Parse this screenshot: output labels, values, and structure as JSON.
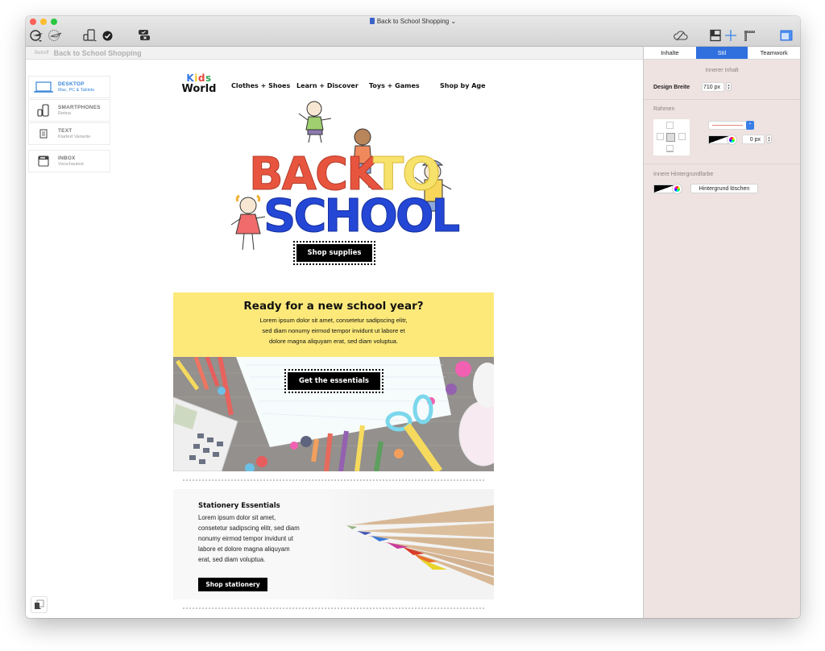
{
  "window": {
    "title": "Back to School Shopping",
    "title_chevron": "⌄"
  },
  "subject": {
    "label": "Betreff",
    "value": "Back to School Shopping"
  },
  "preview_tabs": [
    {
      "title": "DESKTOP",
      "subtitle": "Mac, PC & Tablets",
      "icon": "laptop-icon",
      "active": true
    },
    {
      "title": "SMARTPHONES",
      "subtitle": "Retina",
      "icon": "smartphone-icon",
      "active": false
    },
    {
      "title": "TEXT",
      "subtitle": "Klartext Variante",
      "icon": "text-document-icon",
      "active": false
    },
    {
      "title": "INBOX",
      "subtitle": "Vorschautext",
      "icon": "inbox-icon",
      "active": false
    }
  ],
  "email": {
    "logo": {
      "line1": [
        "K",
        "i",
        "d",
        "s"
      ],
      "line2": "World"
    },
    "nav": [
      "Clothes + Shoes",
      "Learn + Discover",
      "Toys + Games",
      "Shop by Age"
    ],
    "hero": {
      "line1a": "BACK",
      "line1b": "TO",
      "line2": "SCHOOL",
      "button": "Shop supplies"
    },
    "yellow": {
      "title": "Ready for a new school year?",
      "body_lines": [
        "Lorem ipsum dolor sit amet, consetetur sadipscing elitr,",
        "sed diam nonumy eirmod tempor invidunt ut labore et",
        "dolore magna aliquyam erat, sed diam voluptua."
      ]
    },
    "photo": {
      "button": "Get the essentials"
    },
    "stationery": {
      "title": "Stationery Essentials",
      "body_lines": [
        "Lorem ipsum dolor sit amet,",
        "consetetur sadipscing elitr, sed diam",
        "nonumy eirmod tempor invidunt ut",
        "labore et dolore magna aliquyam",
        "erat, sed diam voluptua."
      ],
      "button": "Shop stationery"
    }
  },
  "inspector": {
    "tabs": [
      {
        "label": "Inhalte",
        "active": false
      },
      {
        "label": "Stil",
        "active": true
      },
      {
        "label": "Teamwork",
        "active": false
      }
    ],
    "inner_content": {
      "heading": "Innerer Inhalt",
      "design_width_label": "Design Breite",
      "design_width_value": "710 px"
    },
    "border": {
      "heading": "Rahmen",
      "width_value": "0 px"
    },
    "inner_bg": {
      "heading": "Innere Hintergrundfarbe",
      "clear_button": "Hintergrund löschen"
    }
  },
  "colors": {
    "accent": "#2f6fde",
    "inspector_bg": "#eee3e1",
    "yellow_block": "#fce97a",
    "back_red": "#e8553f",
    "to_yellow": "#f7e26b",
    "school_blue": "#2447d6"
  }
}
